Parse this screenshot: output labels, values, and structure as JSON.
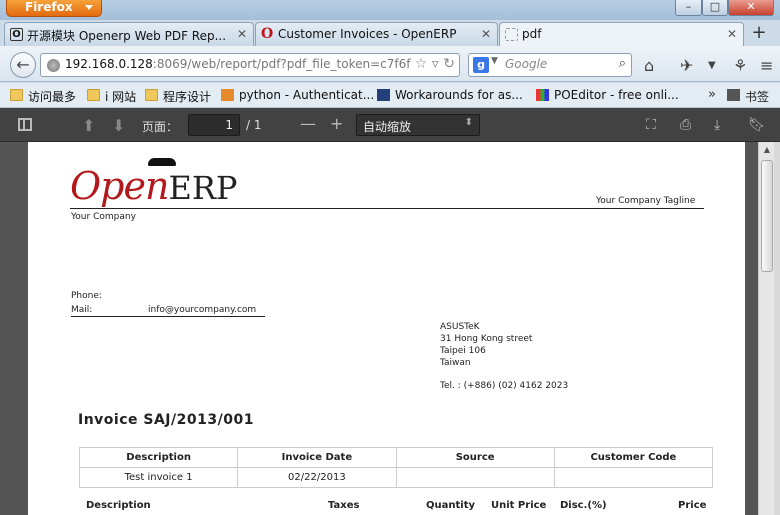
{
  "window": {
    "app_button": "Firefox",
    "controls": {
      "minimize": "–",
      "maximize": "□",
      "close": "✕"
    }
  },
  "tabs": [
    {
      "title": "开源模块 Openerp Web PDF Rep...",
      "icon": "openerp-o-icon"
    },
    {
      "title": "Customer Invoices - OpenERP",
      "icon": "opera-o-icon"
    },
    {
      "title": "pdf",
      "icon": "blank-page-icon",
      "active": true
    }
  ],
  "nav": {
    "url_host": "192.168.0.128",
    "url_rest": ":8069/web/report/pdf?pdf_file_token=c7f6fl",
    "search_placeholder": "Google",
    "search_engine_letter": "g"
  },
  "bookmarks": [
    {
      "label": "访问最多",
      "icon": "folder-icon"
    },
    {
      "label": "i 网站",
      "icon": "folder-icon"
    },
    {
      "label": "程序设计",
      "icon": "folder-icon"
    },
    {
      "label": "python - Authenticat...",
      "icon": "stackoverflow-icon"
    },
    {
      "label": "Workarounds for as...",
      "icon": "bookmark-page-icon"
    },
    {
      "label": "POEditor - free onli...",
      "icon": "poeditor-icon"
    }
  ],
  "bookmarks_more": "»",
  "bookmarks_menu": "书签",
  "pdf_toolbar": {
    "page_label": "页面：",
    "page_current": "1",
    "page_total": "/ 1",
    "zoom_out": "—",
    "zoom_in": "+",
    "zoom_value": "自动缩放"
  },
  "document": {
    "logo_open": "Open",
    "logo_erp": "ERP",
    "tagline": "Your Company Tagline",
    "company_name": "Your Company",
    "phone_label": "Phone:",
    "mail_label": "Mail:",
    "mail_value": "info@yourcompany.com",
    "address": [
      "ASUSTeK",
      "31 Hong Kong street",
      "Taipei 106",
      "Taiwan"
    ],
    "tel": "Tel. : (+886) (02) 4162 2023",
    "invoice_title": "Invoice SAJ/2013/001",
    "info_table": {
      "headers": [
        "Description",
        "Invoice Date",
        "Source",
        "Customer Code"
      ],
      "row": [
        "Test invoice 1",
        "02/22/2013",
        "",
        ""
      ]
    },
    "lines_headers": [
      "Description",
      "Taxes",
      "Quantity",
      "Unit Price",
      "Disc.(%)",
      "Price"
    ]
  }
}
